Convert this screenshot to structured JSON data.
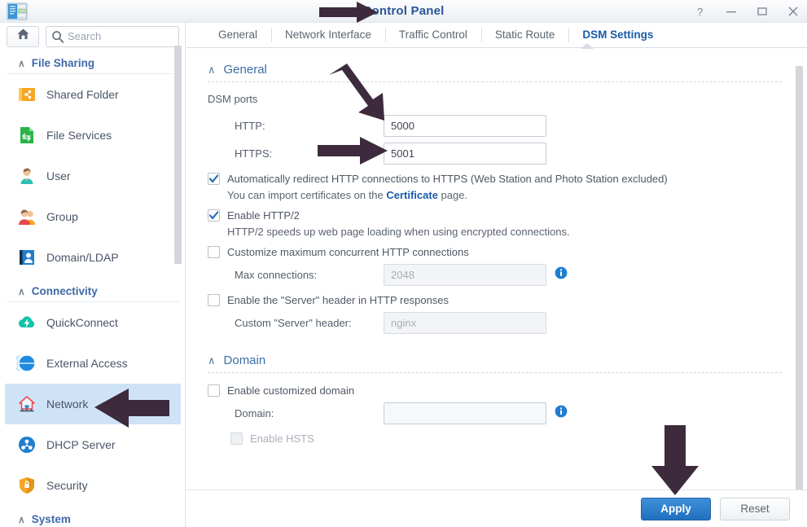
{
  "window": {
    "title": "Control Panel",
    "app_icon": "control-panel-icon",
    "controls": [
      {
        "name": "help-button",
        "glyph": "?"
      },
      {
        "name": "minimize-button",
        "glyph": "–"
      },
      {
        "name": "maximize-button",
        "glyph": "□"
      },
      {
        "name": "close-button",
        "glyph": "✕"
      }
    ]
  },
  "sidebar": {
    "home_icon": "home-icon",
    "search": {
      "placeholder": "Search",
      "value": "",
      "icon": "search-icon"
    },
    "groups": [
      {
        "title": "File Sharing",
        "caret": "∧",
        "items": [
          {
            "label": "Shared Folder",
            "icon": "shared-folder-icon",
            "selected": false
          },
          {
            "label": "File Services",
            "icon": "file-services-icon",
            "selected": false
          },
          {
            "label": "User",
            "icon": "user-icon",
            "selected": false
          },
          {
            "label": "Group",
            "icon": "group-icon",
            "selected": false
          },
          {
            "label": "Domain/LDAP",
            "icon": "domain-ldap-icon",
            "selected": false
          }
        ]
      },
      {
        "title": "Connectivity",
        "caret": "∧",
        "items": [
          {
            "label": "QuickConnect",
            "icon": "quickconnect-icon",
            "selected": false
          },
          {
            "label": "External Access",
            "icon": "external-access-icon",
            "selected": false
          },
          {
            "label": "Network",
            "icon": "network-icon",
            "selected": true
          },
          {
            "label": "DHCP Server",
            "icon": "dhcp-server-icon",
            "selected": false
          },
          {
            "label": "Security",
            "icon": "security-icon",
            "selected": false
          }
        ]
      },
      {
        "title": "System",
        "caret": "∧",
        "items": []
      }
    ]
  },
  "tabs": [
    {
      "label": "General",
      "active": false
    },
    {
      "label": "Network Interface",
      "active": false
    },
    {
      "label": "Traffic Control",
      "active": false
    },
    {
      "label": "Static Route",
      "active": false
    },
    {
      "label": "DSM Settings",
      "active": true
    }
  ],
  "general_section": {
    "title": "General",
    "caret": "∧",
    "dsm_ports_label": "DSM ports",
    "http": {
      "label": "HTTP:",
      "value": "5000"
    },
    "https": {
      "label": "HTTPS:",
      "value": "5001"
    },
    "redirect": {
      "label": "Automatically redirect HTTP connections to HTTPS (Web Station and Photo Station excluded)",
      "checked": true
    },
    "cert_hint_before": "You can import certificates on the ",
    "cert_hint_link": "Certificate",
    "cert_hint_after": " page.",
    "http2": {
      "label": "Enable HTTP/2",
      "checked": true
    },
    "http2_hint": "HTTP/2 speeds up web page loading when using encrypted connections.",
    "max_conn_cb": {
      "label": "Customize maximum concurrent HTTP connections",
      "checked": false
    },
    "max_conn": {
      "label": "Max connections:",
      "value": "2048",
      "disabled": true,
      "info": "info-icon"
    },
    "server_header_cb": {
      "label": "Enable the \"Server\" header in HTTP responses",
      "checked": false
    },
    "server_header": {
      "label": "Custom \"Server\" header:",
      "value": "nginx",
      "disabled": true
    }
  },
  "domain_section": {
    "title": "Domain",
    "caret": "∧",
    "enable_cb": {
      "label": "Enable customized domain",
      "checked": false
    },
    "domain": {
      "label": "Domain:",
      "value": "",
      "disabled": true,
      "info": "info-icon"
    },
    "hsts_cb": {
      "label": "Enable HSTS",
      "checked": false,
      "disabled": true
    }
  },
  "footer": {
    "apply_label": "Apply",
    "reset_label": "Reset"
  },
  "colors": {
    "accent_blue": "#1a5aa8",
    "selected_item_bg": "#cfe3f7",
    "annotation_arrow": "#3d2b3d",
    "primary_button": "#2170bf"
  },
  "annotations": [
    {
      "name": "arrow-to-title",
      "target": "Control Panel title"
    },
    {
      "name": "arrow-to-http-field",
      "target": "HTTP port field"
    },
    {
      "name": "arrow-to-https-field",
      "target": "HTTPS port field"
    },
    {
      "name": "arrow-to-network-item",
      "target": "Network sidebar item"
    },
    {
      "name": "arrow-to-apply-button",
      "target": "Apply button"
    }
  ]
}
